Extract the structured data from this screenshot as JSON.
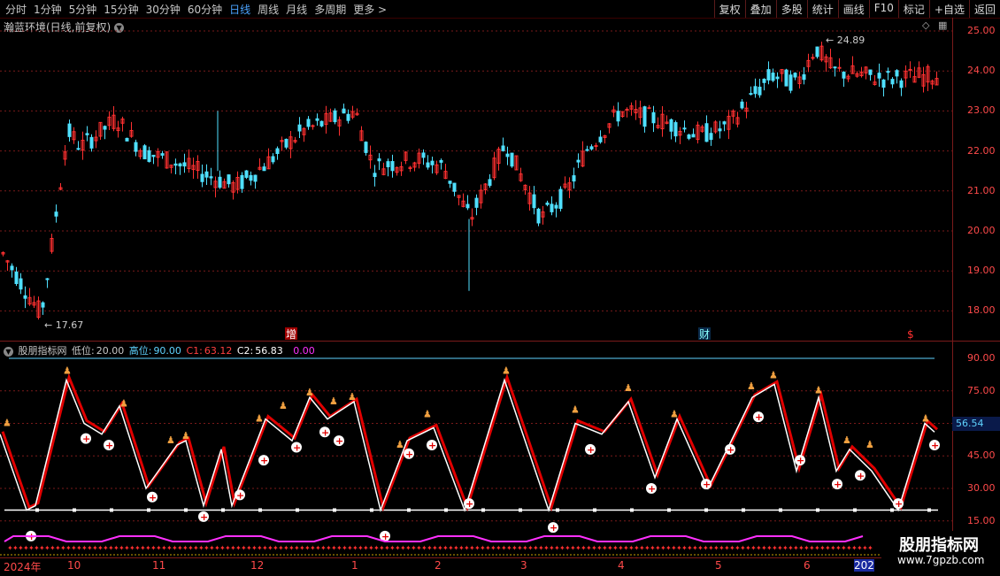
{
  "toolbar": {
    "periods": [
      "分时",
      "1分钟",
      "5分钟",
      "15分钟",
      "30分钟",
      "60分钟",
      "日线",
      "周线",
      "月线",
      "多周期",
      "更多 >"
    ],
    "active_period": "日线",
    "tools": [
      "复权",
      "叠加",
      "多股",
      "统计",
      "画线",
      "F10",
      "标记",
      "+自选",
      "返回"
    ]
  },
  "stock": {
    "title": "瀚蓝环境(日线,前复权)"
  },
  "price_axis": {
    "ticks": [
      "25.00",
      "24.00",
      "23.00",
      "22.00",
      "21.00",
      "20.00",
      "19.00",
      "18.00"
    ]
  },
  "annotations": {
    "high_label": "24.89",
    "low_label": "17.67",
    "markers": [
      "增",
      "财",
      "$"
    ]
  },
  "indicator": {
    "name": "股朋指标网",
    "low_label": "低位:",
    "low_value": "20.00",
    "high_label": "高位:",
    "high_value": "90.00",
    "c1_label": "C1:",
    "c1_value": "63.12",
    "c2_label": "C2:",
    "c2_value": "56.83",
    "c3_value": "0.00",
    "axis_ticks": [
      "90.00",
      "75.00",
      "60.00",
      "45.00",
      "30.00",
      "15.00"
    ],
    "current_value": "56.54"
  },
  "xaxis": {
    "labels": [
      "2024年",
      "10",
      "11",
      "12",
      "1",
      "2",
      "3",
      "4",
      "5",
      "6",
      "202"
    ]
  },
  "watermark": {
    "line1": "股朋指标网",
    "line2": "www.7gpzb.com"
  },
  "colors": {
    "up": "#ff3030",
    "down": "#4fe0ff",
    "line_red": "#e00000",
    "line_white": "#ffffff",
    "magenta": "#ff30ff"
  }
}
